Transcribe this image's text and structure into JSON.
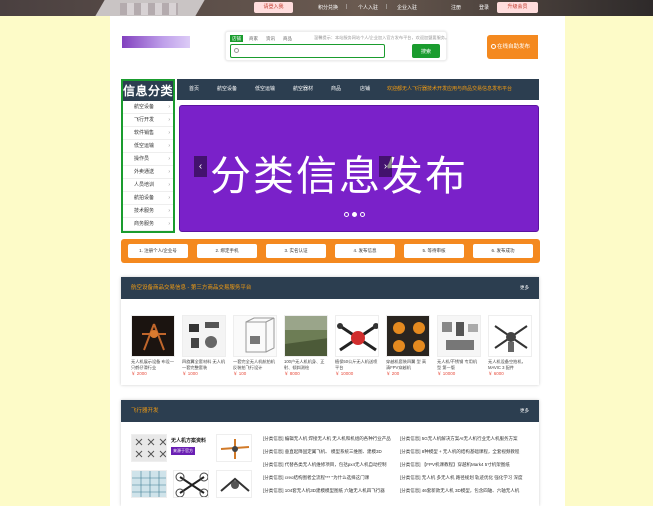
{
  "topbar": {
    "cta_left": "请登入我",
    "links": [
      "积分兑换",
      "个人入驻",
      "企业入驻"
    ],
    "register": "注册",
    "login": "登录",
    "cta_right": "升级会员"
  },
  "search": {
    "tabs": [
      "店铺",
      "商家",
      "资讯",
      "商品"
    ],
    "hint": "温馨提示：本站服务网站个人/企业加入官方发布平台，欢迎加盟要服务。",
    "placeholder": "",
    "button": "搜索"
  },
  "publish_label": "在线自助发布",
  "categories": {
    "title": "信息分类",
    "items": [
      "航空设备",
      "飞行开发",
      "软件销售",
      "低空运输",
      "操作员",
      "外卖通送",
      "人员培训",
      "航拍设备",
      "技术服务",
      "商务服务"
    ]
  },
  "nav": {
    "items": [
      "首页",
      "航空设备",
      "低空运输",
      "航空器材",
      "商品",
      "店铺"
    ],
    "marquee": "欢迎都无人飞行器技术开发应用与商品交易信息发布平台"
  },
  "banner": {
    "text": "分类信息发布",
    "prev": "‹",
    "next": "›"
  },
  "steps": [
    "1. 注册个人/企业号",
    "2. 绑定手机",
    "3. 实名认证",
    "4. 发布信息",
    "5. 等待审核",
    "6. 发布成功"
  ],
  "section1": {
    "title": "航空设备商品交易信息 - 第三方商品交易服务平台",
    "more": "更多",
    "products": [
      {
        "name": "无人机展示设备 布设一只鹤仔滑行业",
        "price": "￥ 2000"
      },
      {
        "name": "四旋翼全套材料 无人机 一套完整套装",
        "price": "￥ 1000"
      },
      {
        "name": "一套完全无人机航拍机 反装拍飞行设计",
        "price": "￥ 100"
      },
      {
        "name": "100户无人机机身、正射、倾斜测绘",
        "price": "￥ 8000"
      },
      {
        "name": "植保50公斤无人机送喷平台",
        "price": "￥ 10000"
      },
      {
        "name": "穿越机套装四翼 型 高清FPV穿越机",
        "price": "￥ 200"
      },
      {
        "name": "无人机/不锈钢 专用机型 第一版",
        "price": "￥ 10000"
      },
      {
        "name": "无人机设备空拍机，MAVIC 3 配件",
        "price": "￥ 6000"
      }
    ]
  },
  "section2": {
    "title": "飞行器开发",
    "more": "更多",
    "promo_title": "无人机方案资料",
    "promo_sub": "来源于官方",
    "news_left": [
      "[分类信息] 编辑无人机 焊接无人机 无人机和机组的各种行业产品",
      "[分类信息] 垂直起降固定翼飞机、 模型系统三维图、建模3D",
      "[分类信息] 代替各类无人机维修项目，包括px4无人机自动控制",
      "[分类信息] creo结构图者全流程*** \"为什么选择这门课",
      "[分类信息] 104套无人机3D建模模型图纸 六轴无人机四飞行器"
    ],
    "news_right": [
      "[分类信息] 5G无人机解决方案AI无人机行业无人机服务方案",
      "[分类信息] 8种模型 + 无人机的结构基础课程，全套视频教程",
      "[分类信息] 【FPV机课教程】穿越机Mark4 5寸机架图纸",
      "[分类信息] 无人机 多无人机 路径规划 轨迹优化 强化学习 深度",
      "[分类信息] 46套新款无人机 3D模型，包含四轴、六轴无人机"
    ]
  }
}
